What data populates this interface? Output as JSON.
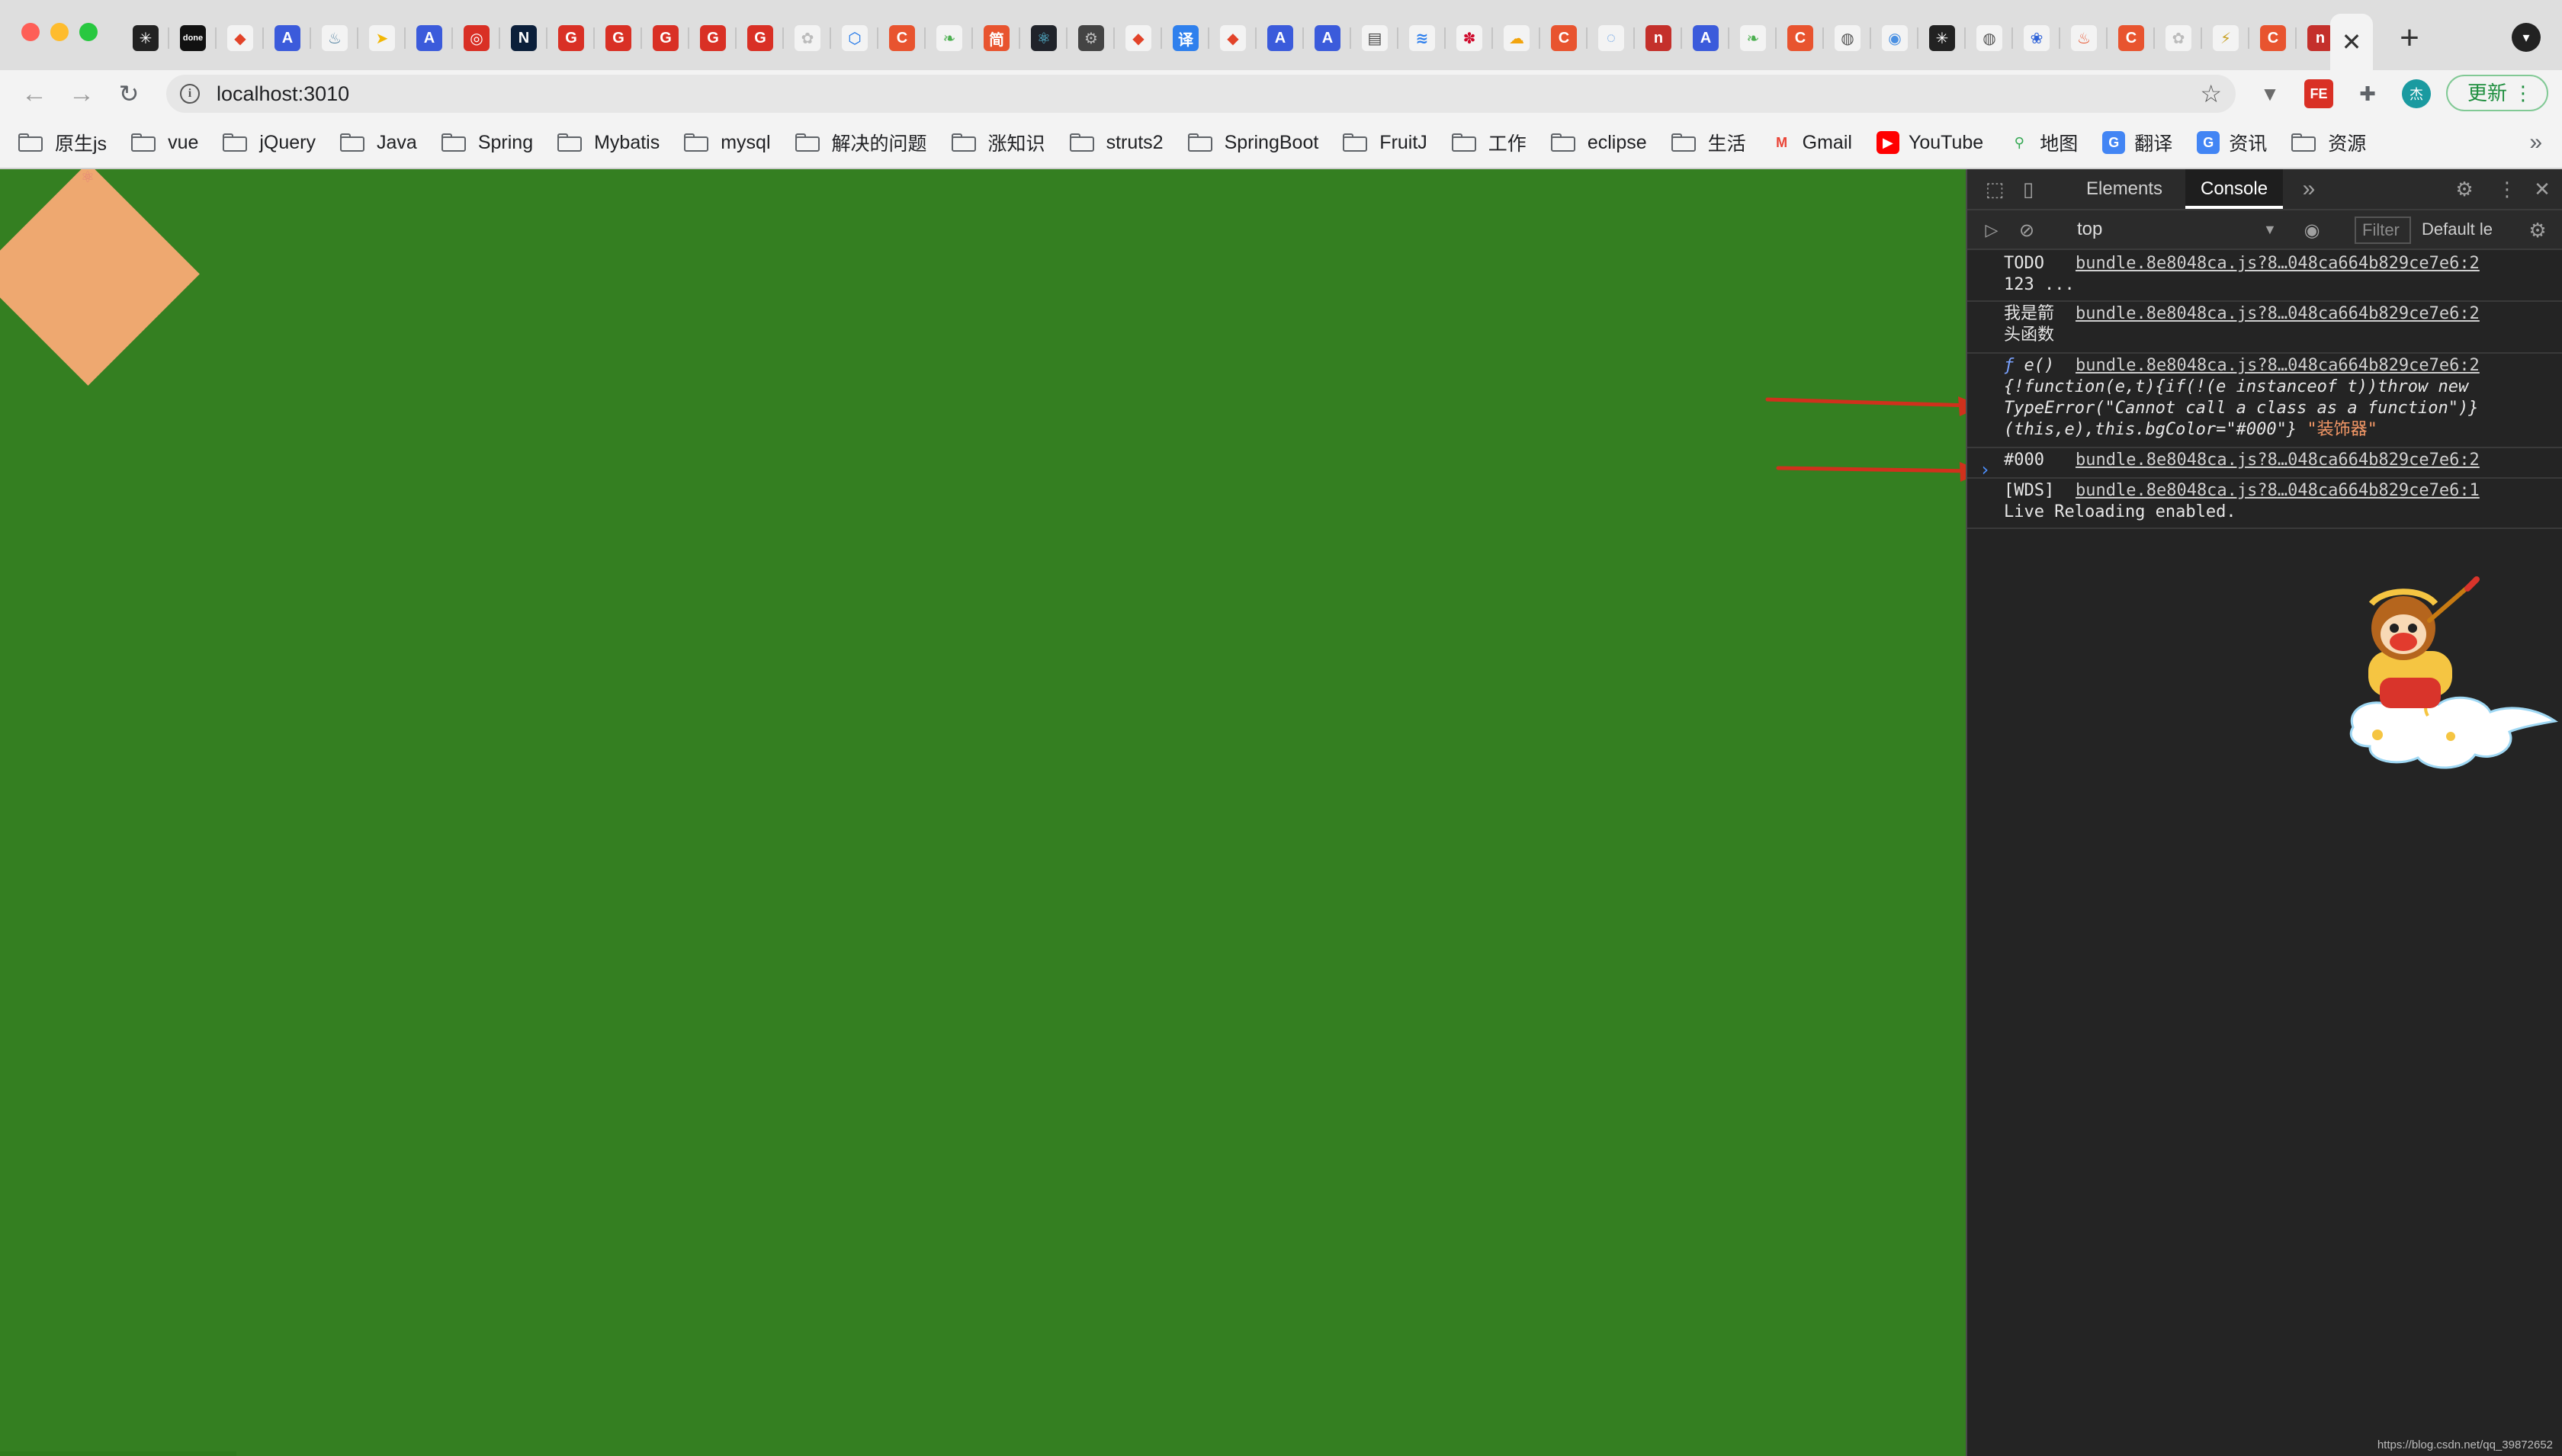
{
  "window": {
    "controls": [
      "close",
      "minimize",
      "zoom"
    ]
  },
  "tabs": [
    {
      "label": "✳",
      "bg": "#222222",
      "fg": "#ffffff"
    },
    {
      "label": "done",
      "bg": "#111111",
      "fg": "#ffffff"
    },
    {
      "label": "◆",
      "bg": "#f3f3f3",
      "fg": "#e24329"
    },
    {
      "label": "A",
      "bg": "#3b5bdb",
      "fg": "#ffffff"
    },
    {
      "label": "♨",
      "bg": "#f3f3f3",
      "fg": "#5382a1"
    },
    {
      "label": "➤",
      "bg": "#f3f3f3",
      "fg": "#f2b705"
    },
    {
      "label": "A",
      "bg": "#3b5bdb",
      "fg": "#ffffff"
    },
    {
      "label": "◎",
      "bg": "#d93025",
      "fg": "#ffffff"
    },
    {
      "label": "N",
      "bg": "#0b1f3a",
      "fg": "#ffffff"
    },
    {
      "label": "G",
      "bg": "#d93025",
      "fg": "#ffffff"
    },
    {
      "label": "G",
      "bg": "#d93025",
      "fg": "#ffffff"
    },
    {
      "label": "G",
      "bg": "#d93025",
      "fg": "#ffffff"
    },
    {
      "label": "G",
      "bg": "#d93025",
      "fg": "#ffffff"
    },
    {
      "label": "G",
      "bg": "#d93025",
      "fg": "#ffffff"
    },
    {
      "label": "✿",
      "bg": "#f3f3f3",
      "fg": "#bbbbbb"
    },
    {
      "label": "⬡",
      "bg": "#f3f3f3",
      "fg": "#1a73e8"
    },
    {
      "label": "C",
      "bg": "#e8542f",
      "fg": "#ffffff"
    },
    {
      "label": "❧",
      "bg": "#f3f3f3",
      "fg": "#4caf50"
    },
    {
      "label": "简",
      "bg": "#e8542f",
      "fg": "#ffffff"
    },
    {
      "label": "⚛",
      "bg": "#20232a",
      "fg": "#61dafb"
    },
    {
      "label": "⚙",
      "bg": "#444444",
      "fg": "#bbbbbb"
    },
    {
      "label": "◆",
      "bg": "#f3f3f3",
      "fg": "#e24329"
    },
    {
      "label": "译",
      "bg": "#2f80ed",
      "fg": "#ffffff"
    },
    {
      "label": "◆",
      "bg": "#f3f3f3",
      "fg": "#e24329"
    },
    {
      "label": "A",
      "bg": "#3b5bdb",
      "fg": "#ffffff"
    },
    {
      "label": "A",
      "bg": "#3b5bdb",
      "fg": "#ffffff"
    },
    {
      "label": "▤",
      "bg": "#f3f3f3",
      "fg": "#444444"
    },
    {
      "label": "≋",
      "bg": "#f3f3f3",
      "fg": "#2f80ed"
    },
    {
      "label": "✽",
      "bg": "#f3f3f3",
      "fg": "#cf0a2c"
    },
    {
      "label": "☁",
      "bg": "#f3f3f3",
      "fg": "#f2a40d"
    },
    {
      "label": "C",
      "bg": "#e8542f",
      "fg": "#ffffff"
    },
    {
      "label": "◌",
      "bg": "#f3f3f3",
      "fg": "#4a90e2"
    },
    {
      "label": "n",
      "bg": "#c4302b",
      "fg": "#ffffff"
    },
    {
      "label": "A",
      "bg": "#3b5bdb",
      "fg": "#ffffff"
    },
    {
      "label": "❧",
      "bg": "#f3f3f3",
      "fg": "#4caf50"
    },
    {
      "label": "C",
      "bg": "#e8542f",
      "fg": "#ffffff"
    },
    {
      "label": "◍",
      "bg": "#f3f3f3",
      "fg": "#555555"
    },
    {
      "label": "◉",
      "bg": "#f3f3f3",
      "fg": "#4a90e2"
    },
    {
      "label": "✳",
      "bg": "#222222",
      "fg": "#ffffff"
    },
    {
      "label": "◍",
      "bg": "#f3f3f3",
      "fg": "#555555"
    },
    {
      "label": "❀",
      "bg": "#f3f3f3",
      "fg": "#2f63d8"
    },
    {
      "label": "♨",
      "bg": "#f3f3f3",
      "fg": "#e8542f"
    },
    {
      "label": "C",
      "bg": "#e8542f",
      "fg": "#ffffff"
    },
    {
      "label": "✿",
      "bg": "#f3f3f3",
      "fg": "#bbbbbb"
    },
    {
      "label": "⚡",
      "bg": "#f3f3f3",
      "fg": "#c9a227"
    },
    {
      "label": "C",
      "bg": "#e8542f",
      "fg": "#ffffff"
    },
    {
      "label": "n",
      "bg": "#c4302b",
      "fg": "#ffffff"
    }
  ],
  "toolbar": {
    "url": "localhost:3010",
    "update_label": "更新",
    "profile_initial": "杰",
    "extension_label": "FE"
  },
  "bookmarks": [
    {
      "label": "原生js",
      "type": "folder"
    },
    {
      "label": "vue",
      "type": "folder"
    },
    {
      "label": "jQuery",
      "type": "folder"
    },
    {
      "label": "Java",
      "type": "folder"
    },
    {
      "label": "Spring",
      "type": "folder"
    },
    {
      "label": "Mybatis",
      "type": "folder"
    },
    {
      "label": "mysql",
      "type": "folder"
    },
    {
      "label": "解决的问题",
      "type": "folder"
    },
    {
      "label": "涨知识",
      "type": "folder"
    },
    {
      "label": "struts2",
      "type": "folder"
    },
    {
      "label": "SpringBoot",
      "type": "folder"
    },
    {
      "label": "FruitJ",
      "type": "folder"
    },
    {
      "label": "工作",
      "type": "folder"
    },
    {
      "label": "eclipse",
      "type": "folder"
    },
    {
      "label": "生活",
      "type": "folder"
    },
    {
      "label": "Gmail",
      "type": "link",
      "icon": "M",
      "bg": "#f3f3f3",
      "fg": "#ea4335"
    },
    {
      "label": "YouTube",
      "type": "link",
      "icon": "▶",
      "bg": "#ff0000",
      "fg": "#ffffff"
    },
    {
      "label": "地图",
      "type": "link",
      "icon": "⚲",
      "bg": "#f3f3f3",
      "fg": "#34a853"
    },
    {
      "label": "翻译",
      "type": "link",
      "icon": "G",
      "bg": "#4285f4",
      "fg": "#ffffff"
    },
    {
      "label": "资讯",
      "type": "link",
      "icon": "G",
      "bg": "#4285f4",
      "fg": "#ffffff"
    },
    {
      "label": "资源",
      "type": "folder"
    }
  ],
  "bookmarks_more": "»",
  "page": {
    "background": "#347f21",
    "shape_color": "#eea870"
  },
  "devtools": {
    "tabs": [
      "Elements",
      "Console"
    ],
    "more_tabs": "»",
    "active_tab": "Console",
    "context": "top",
    "filter_placeholder": "Filter",
    "levels": "Default le",
    "messages": [
      {
        "text": "TODO\n123 ...",
        "source": "bundle.8e8048ca.js?8…048ca664b829ce7e6:2"
      },
      {
        "text": "我是箭\n头函数",
        "source": "bundle.8e8048ca.js?8…048ca664b829ce7e6:2"
      },
      {
        "fn_prefix": "ƒ",
        "fn_name": "e()",
        "source": "bundle.8e8048ca.js?8…048ca664b829ce7e6:2",
        "code_1": "{!function(e,t){if(!(e instanceof t))throw new",
        "code_2": "TypeError(\"Cannot call a class as a function\")}",
        "code_3": "(this,e),this.bgColor=\"#000\"} ",
        "code_str": "\"装饰器\""
      },
      {
        "text": "#000",
        "source": "bundle.8e8048ca.js?8…048ca664b829ce7e6:2"
      },
      {
        "text": "[WDS]",
        "source": "bundle.8e8048ca.js?8…048ca664b829ce7e6:1",
        "code_1": "Live Reloading enabled."
      }
    ],
    "prompt": "›"
  },
  "watermark": "https://blog.csdn.net/qq_39872652",
  "colors": {
    "arrow": "#d0311c",
    "accent_green": "#1e8e3e"
  }
}
